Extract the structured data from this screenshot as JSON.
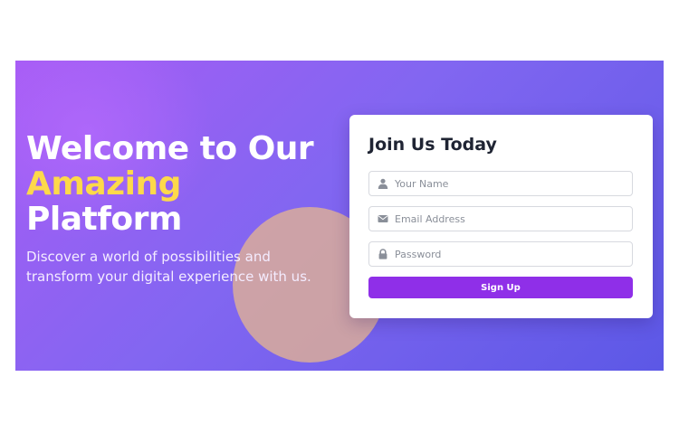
{
  "hero": {
    "heading_line1": "Welcome to Our",
    "heading_accent": "Amazing",
    "heading_line3": "Platform",
    "subtitle": "Discover a world of possibilities and transform your digital experience with us."
  },
  "form": {
    "title": "Join Us Today",
    "name_placeholder": "Your Name",
    "email_placeholder": "Email Address",
    "password_placeholder": "Password",
    "submit_label": "Sign Up"
  },
  "icons": {
    "name": "user-icon",
    "email": "envelope-icon",
    "password": "lock-icon"
  },
  "colors": {
    "gradient_start": "#a75cf5",
    "gradient_end": "#5c58e6",
    "accent_text": "#fdd94a",
    "button": "#8f2fe8",
    "circle": "#deb096"
  }
}
